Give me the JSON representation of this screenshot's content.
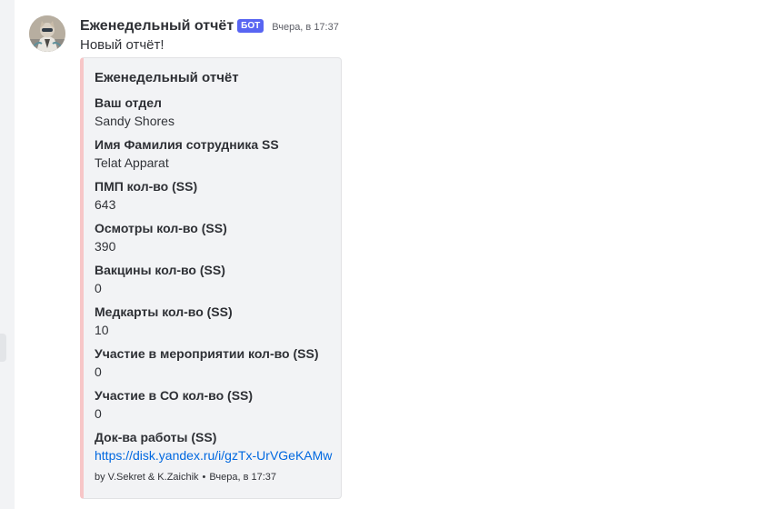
{
  "message": {
    "author": "Еженедельный отчёт",
    "bot_tag": "БОТ",
    "timestamp": "Вчера, в 17:37",
    "content": "Новый отчёт!"
  },
  "embed": {
    "color": "#f7c6c7",
    "title": "Еженедельный отчёт",
    "fields": [
      {
        "name": "Ваш отдел",
        "value": "Sandy Shores"
      },
      {
        "name": "Имя Фамилия сотрудника SS",
        "value": "Telat Apparat"
      },
      {
        "name": "ПМП кол-во (SS)",
        "value": "643"
      },
      {
        "name": "Осмотры кол-во (SS)",
        "value": "390"
      },
      {
        "name": "Вакцины кол-во (SS)",
        "value": "0"
      },
      {
        "name": "Медкарты кол-во (SS)",
        "value": "10"
      },
      {
        "name": "Участие в мероприятии кол-во (SS)",
        "value": "0"
      },
      {
        "name": "Участие в СО кол-во (SS)",
        "value": "0"
      },
      {
        "name": "Док-ва работы (SS)",
        "value": "https://disk.yandex.ru/i/gzTx-UrVGeKAMw"
      }
    ],
    "footer": {
      "text": "by V.Sekret & K.Zaichik",
      "separator": "•",
      "timestamp": "Вчера, в 17:37"
    }
  },
  "colors": {
    "bot_tag": "#5865f2",
    "link": "#0068e0",
    "embed_background": "#f2f3f5"
  }
}
